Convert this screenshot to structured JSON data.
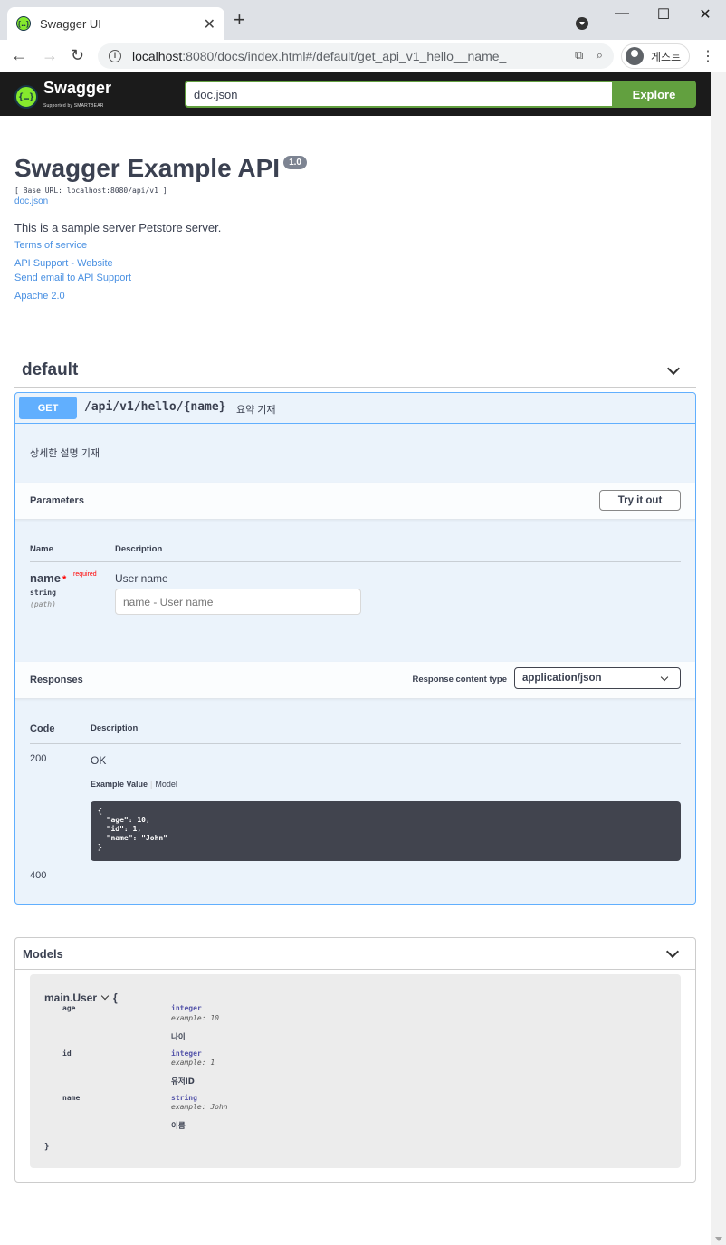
{
  "browser": {
    "tab_title": "Swagger UI",
    "url_host": "localhost",
    "url_rest": ":8080/docs/index.html#/default/get_api_v1_hello__name_",
    "profile_label": "게스트"
  },
  "topbar": {
    "logo_text": "Swagger",
    "logo_sub": "Supported by SMARTBEAR",
    "url_value": "doc.json",
    "explore_label": "Explore",
    "accent": "#62a03f"
  },
  "info": {
    "title": "Swagger Example API",
    "version": "1.0",
    "base_url": "[ Base URL: localhost:8080/api/v1 ]",
    "spec_link": "doc.json",
    "description": "This is a sample server Petstore server.",
    "terms": "Terms of service",
    "support_website": "API Support - Website",
    "support_email": "Send email to API Support",
    "license": "Apache 2.0"
  },
  "section": {
    "title": "default"
  },
  "operation": {
    "method": "GET",
    "method_color": "#61affe",
    "path": "/api/v1/hello/{name}",
    "summary": "요약 기재",
    "description": "상세한 설명 기재",
    "parameters_label": "Parameters",
    "try_it_out_label": "Try it out",
    "col_name": "Name",
    "col_description": "Description",
    "param": {
      "name": "name",
      "star": "*",
      "required": "required",
      "type": "string",
      "in": "(path)",
      "description": "User name",
      "placeholder": "name - User name"
    },
    "responses_label": "Responses",
    "content_type_label": "Response content type",
    "content_type_value": "application/json",
    "col_code": "Code",
    "responses": [
      {
        "code": "200",
        "description": "OK",
        "example_value_tab": "Example Value",
        "model_tab": "Model",
        "example": "{\n  \"age\": 10,\n  \"id\": 1,\n  \"name\": \"John\"\n}"
      },
      {
        "code": "400"
      }
    ]
  },
  "models": {
    "title": "Models",
    "model_name": "main.User",
    "open_brace": "{",
    "close_brace": "}",
    "properties": [
      {
        "name": "age",
        "type": "integer",
        "example": "example: 10",
        "description": "나이"
      },
      {
        "name": "id",
        "type": "integer",
        "example": "example: 1",
        "description": "유저ID"
      },
      {
        "name": "name",
        "type": "string",
        "example": "example: John",
        "description": "이름"
      }
    ]
  }
}
